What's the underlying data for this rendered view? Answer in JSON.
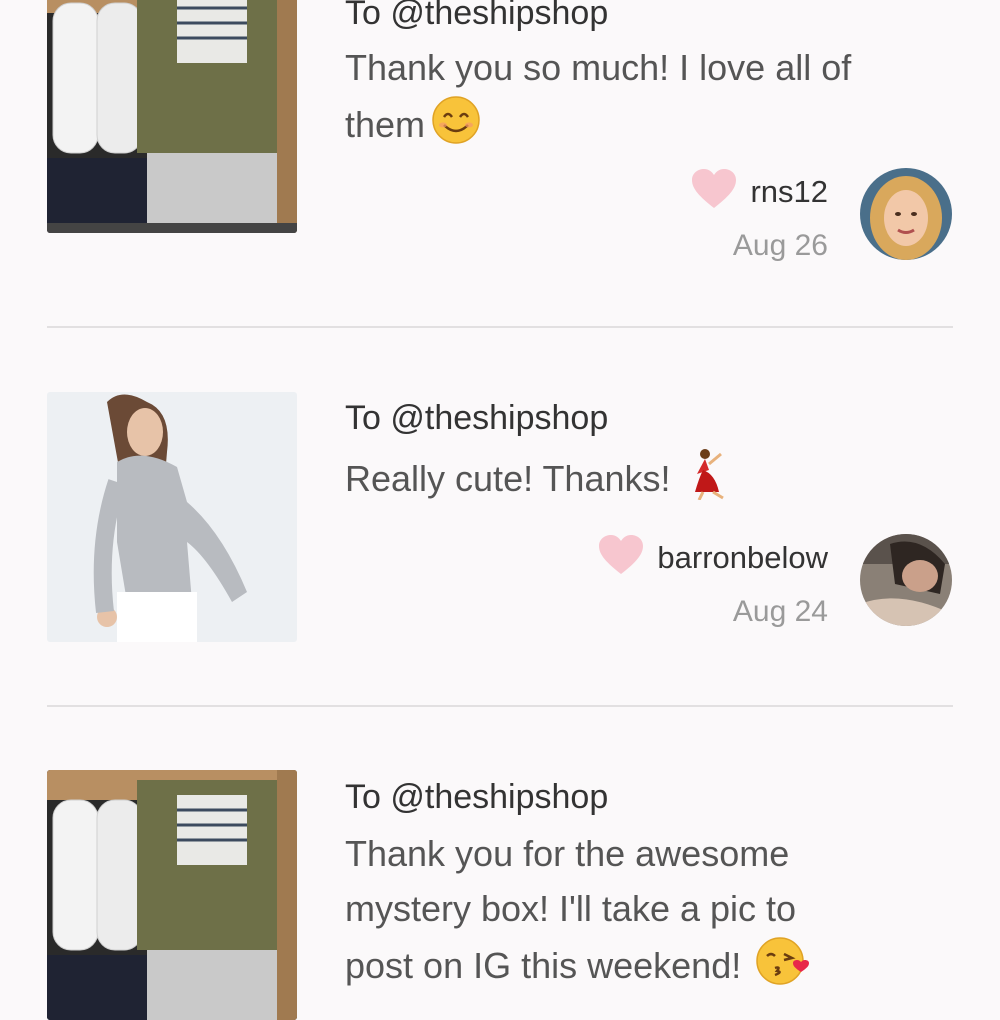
{
  "colors": {
    "background": "#fbf9fa",
    "heart": "#f7c6cf",
    "divider": "#e2e0e1",
    "date": "#9a9a9a"
  },
  "posts": [
    {
      "to": "To @theshipshop",
      "message_lines": [
        "Thank you so much! I love all of",
        "them"
      ],
      "emoji": "smiling-face-icon",
      "username": "rns12",
      "date": "Aug 26",
      "thumb": "clothing-box-image",
      "avatar": "blonde-woman-avatar"
    },
    {
      "to": "To @theshipshop",
      "message_lines": [
        "Really cute! Thanks!"
      ],
      "emoji": "dancer-icon",
      "username": "barronbelow",
      "date": "Aug 24",
      "thumb": "model-gray-henley-image",
      "avatar": "dark-hair-woman-avatar"
    },
    {
      "to": "To @theshipshop",
      "message_lines": [
        "Thank you for the awesome",
        "mystery box! I'll take a pic to",
        "post on IG this weekend!"
      ],
      "emoji": "face-blowing-kiss-icon",
      "thumb": "clothing-box-image"
    }
  ]
}
